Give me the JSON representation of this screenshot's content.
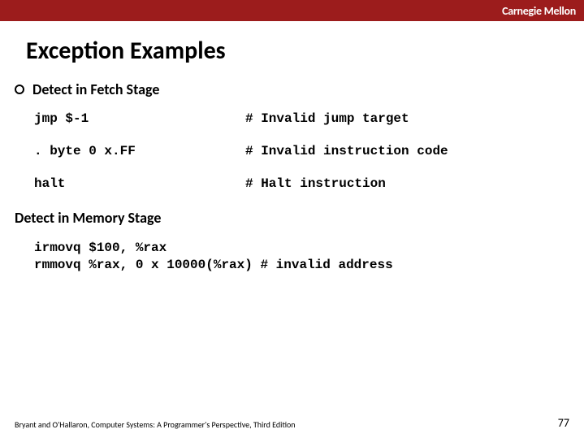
{
  "header": {
    "brand": "Carnegie Mellon"
  },
  "title": "Exception Examples",
  "section1": {
    "heading": "Detect in Fetch Stage",
    "rows": [
      {
        "code": "jmp $-1",
        "comment": "# Invalid jump target"
      },
      {
        "code": ". byte 0 x.FF",
        "comment": "# Invalid instruction code"
      },
      {
        "code": "halt",
        "comment": "# Halt instruction"
      }
    ]
  },
  "section2": {
    "heading": "Detect in Memory Stage",
    "block": "irmovq $100, %rax\nrmmovq %rax, 0 x 10000(%rax) # invalid address"
  },
  "footer": {
    "citation": "Bryant and O'Hallaron, Computer Systems: A Programmer's Perspective, Third Edition",
    "page": "77"
  }
}
